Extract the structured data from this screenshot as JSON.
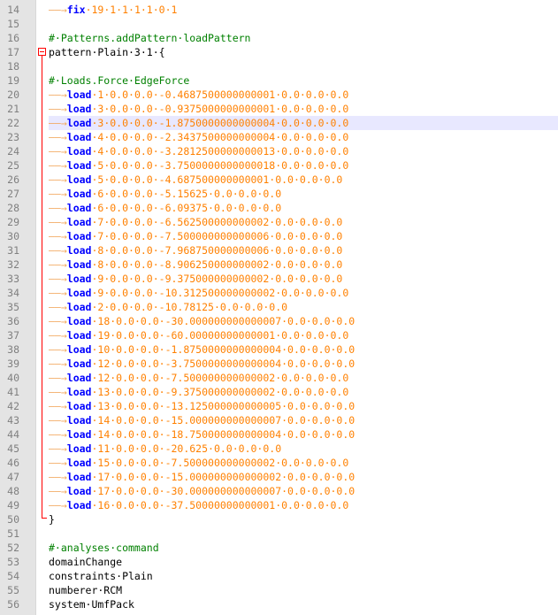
{
  "editor": {
    "current_line": 22,
    "colors": {
      "comment": "#008000",
      "keyword": "#0000ff",
      "args": "#ff8000",
      "whitespace": "#f2a65a",
      "gutter": "#e4e4e4",
      "line_number": "#808080",
      "current_line": "#e8e8ff",
      "fold_marker": "#ff0000"
    },
    "lines": [
      {
        "n": "14",
        "kind": "cmd",
        "cmd": "fix",
        "args": "·19·1·1·1·1·0·1"
      },
      {
        "n": "15",
        "kind": "empty"
      },
      {
        "n": "16",
        "kind": "comment",
        "text": "#·Patterns.addPattern·loadPattern"
      },
      {
        "n": "17",
        "kind": "plain",
        "text": "pattern·Plain·3·1·{"
      },
      {
        "n": "18",
        "kind": "empty"
      },
      {
        "n": "19",
        "kind": "comment",
        "text": "#·Loads.Force·EdgeForce"
      },
      {
        "n": "20",
        "kind": "load",
        "args": "·1·0.0·0.0·-0.4687500000000001·0.0·0.0·0.0"
      },
      {
        "n": "21",
        "kind": "load",
        "args": "·3·0.0·0.0·-0.9375000000000001·0.0·0.0·0.0"
      },
      {
        "n": "22",
        "kind": "load",
        "args": "·3·0.0·0.0·-1.8750000000000004·0.0·0.0·0.0"
      },
      {
        "n": "23",
        "kind": "load",
        "args": "·4·0.0·0.0·-2.3437500000000004·0.0·0.0·0.0"
      },
      {
        "n": "24",
        "kind": "load",
        "args": "·4·0.0·0.0·-3.2812500000000013·0.0·0.0·0.0"
      },
      {
        "n": "25",
        "kind": "load",
        "args": "·5·0.0·0.0·-3.7500000000000018·0.0·0.0·0.0"
      },
      {
        "n": "26",
        "kind": "load",
        "args": "·5·0.0·0.0·-4.687500000000001·0.0·0.0·0.0"
      },
      {
        "n": "27",
        "kind": "load",
        "args": "·6·0.0·0.0·-5.15625·0.0·0.0·0.0"
      },
      {
        "n": "28",
        "kind": "load",
        "args": "·6·0.0·0.0·-6.09375·0.0·0.0·0.0"
      },
      {
        "n": "29",
        "kind": "load",
        "args": "·7·0.0·0.0·-6.562500000000002·0.0·0.0·0.0"
      },
      {
        "n": "30",
        "kind": "load",
        "args": "·7·0.0·0.0·-7.500000000000006·0.0·0.0·0.0"
      },
      {
        "n": "31",
        "kind": "load",
        "args": "·8·0.0·0.0·-7.968750000000006·0.0·0.0·0.0"
      },
      {
        "n": "32",
        "kind": "load",
        "args": "·8·0.0·0.0·-8.906250000000002·0.0·0.0·0.0"
      },
      {
        "n": "33",
        "kind": "load",
        "args": "·9·0.0·0.0·-9.375000000000002·0.0·0.0·0.0"
      },
      {
        "n": "34",
        "kind": "load",
        "args": "·9·0.0·0.0·-10.312500000000002·0.0·0.0·0.0"
      },
      {
        "n": "35",
        "kind": "load",
        "args": "·2·0.0·0.0·-10.78125·0.0·0.0·0.0"
      },
      {
        "n": "36",
        "kind": "load",
        "args": "·18·0.0·0.0·-30.000000000000007·0.0·0.0·0.0"
      },
      {
        "n": "37",
        "kind": "load",
        "args": "·19·0.0·0.0·-60.00000000000001·0.0·0.0·0.0"
      },
      {
        "n": "38",
        "kind": "load",
        "args": "·10·0.0·0.0·-1.8750000000000004·0.0·0.0·0.0"
      },
      {
        "n": "39",
        "kind": "load",
        "args": "·12·0.0·0.0·-3.7500000000000004·0.0·0.0·0.0"
      },
      {
        "n": "40",
        "kind": "load",
        "args": "·12·0.0·0.0·-7.500000000000002·0.0·0.0·0.0"
      },
      {
        "n": "41",
        "kind": "load",
        "args": "·13·0.0·0.0·-9.375000000000002·0.0·0.0·0.0"
      },
      {
        "n": "42",
        "kind": "load",
        "args": "·13·0.0·0.0·-13.125000000000005·0.0·0.0·0.0"
      },
      {
        "n": "43",
        "kind": "load",
        "args": "·14·0.0·0.0·-15.000000000000007·0.0·0.0·0.0"
      },
      {
        "n": "44",
        "kind": "load",
        "args": "·14·0.0·0.0·-18.750000000000004·0.0·0.0·0.0"
      },
      {
        "n": "45",
        "kind": "load",
        "args": "·11·0.0·0.0·-20.625·0.0·0.0·0.0"
      },
      {
        "n": "46",
        "kind": "load",
        "args": "·15·0.0·0.0·-7.500000000000002·0.0·0.0·0.0"
      },
      {
        "n": "47",
        "kind": "load",
        "args": "·17·0.0·0.0·-15.000000000000002·0.0·0.0·0.0"
      },
      {
        "n": "48",
        "kind": "load",
        "args": "·17·0.0·0.0·-30.000000000000007·0.0·0.0·0.0"
      },
      {
        "n": "49",
        "kind": "load",
        "args": "·16·0.0·0.0·-37.50000000000001·0.0·0.0·0.0"
      },
      {
        "n": "50",
        "kind": "plain",
        "text": "}"
      },
      {
        "n": "51",
        "kind": "empty"
      },
      {
        "n": "52",
        "kind": "comment",
        "text": "#·analyses·command"
      },
      {
        "n": "53",
        "kind": "plain",
        "text": "domainChange"
      },
      {
        "n": "54",
        "kind": "plain",
        "text": "constraints·Plain"
      },
      {
        "n": "55",
        "kind": "plain",
        "text": "numberer·RCM"
      },
      {
        "n": "56",
        "kind": "plain",
        "text": "system·UmfPack"
      }
    ]
  }
}
